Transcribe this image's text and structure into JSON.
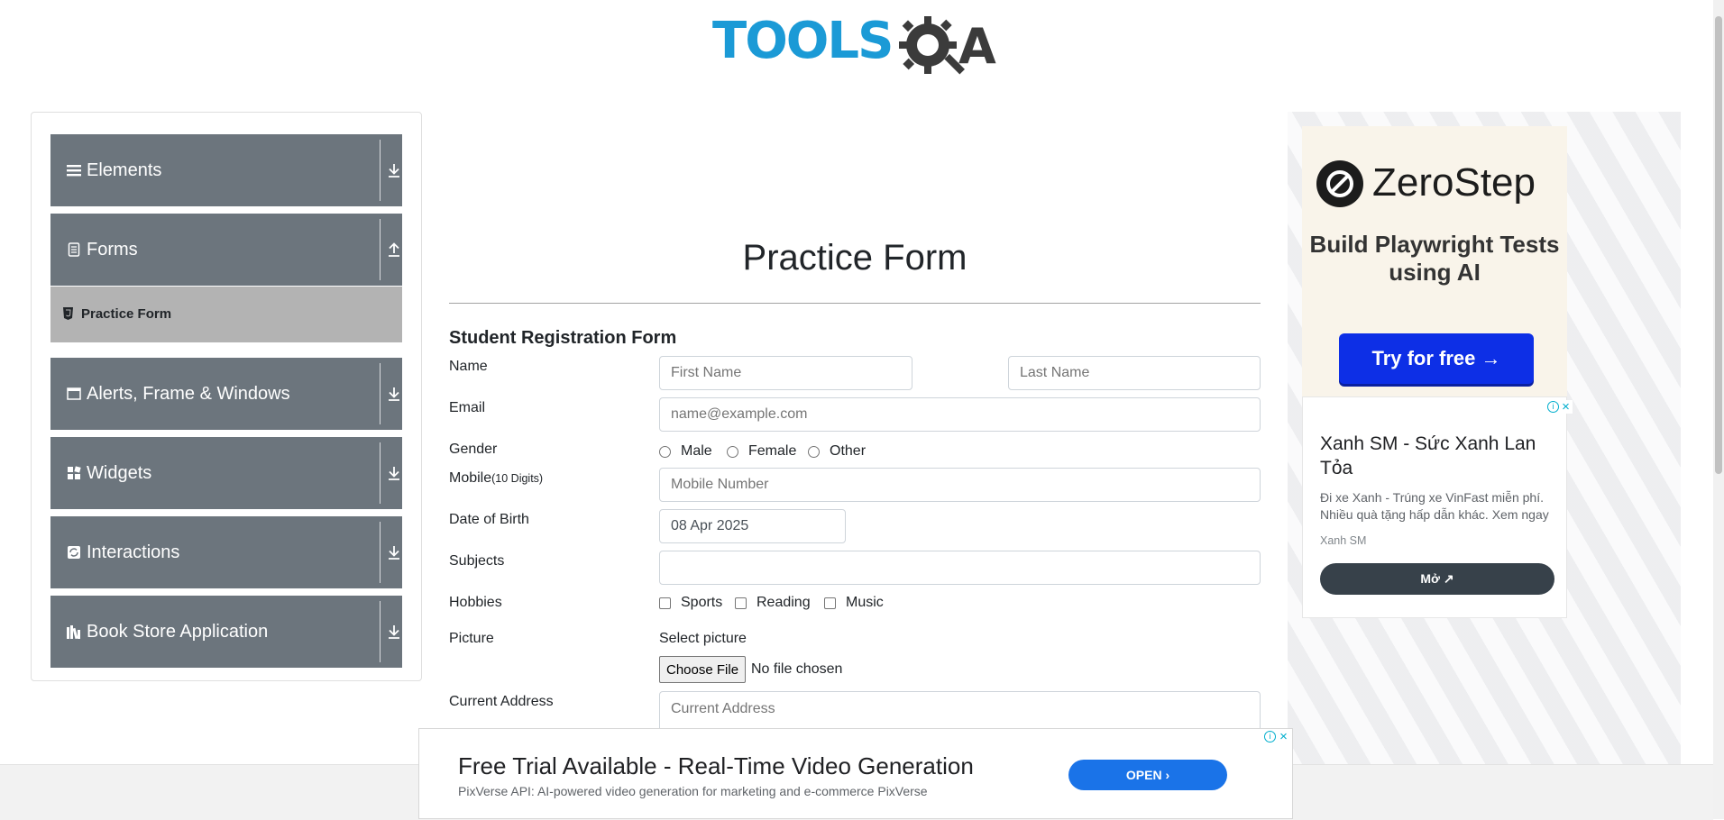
{
  "header": {
    "logo_left": "TOOLS",
    "logo_right": "QA"
  },
  "sidebar": {
    "groups": [
      {
        "label": "Elements",
        "icon": "list-icon",
        "arrow": "download-icon"
      },
      {
        "label": "Forms",
        "icon": "form-icon",
        "arrow": "upload-icon"
      },
      {
        "label": "Alerts, Frame & Windows",
        "icon": "window-icon",
        "arrow": "download-icon"
      },
      {
        "label": "Widgets",
        "icon": "widgets-icon",
        "arrow": "download-icon"
      },
      {
        "label": "Interactions",
        "icon": "interactions-icon",
        "arrow": "download-icon"
      },
      {
        "label": "Book Store Application",
        "icon": "books-icon",
        "arrow": "download-icon"
      }
    ],
    "active_item": {
      "label": "Practice Form",
      "icon": "html5-icon"
    }
  },
  "main": {
    "page_title": "Practice Form",
    "form_title": "Student Registration Form",
    "labels": {
      "name": "Name",
      "email": "Email",
      "gender": "Gender",
      "mobile": "Mobile",
      "mobile_hint": "(10 Digits)",
      "dob": "Date of Birth",
      "subjects": "Subjects",
      "hobbies": "Hobbies",
      "picture": "Picture",
      "address": "Current Address"
    },
    "placeholders": {
      "first_name": "First Name",
      "last_name": "Last Name",
      "email": "name@example.com",
      "mobile": "Mobile Number",
      "address": "Current Address"
    },
    "dob_value": "08 Apr 2025",
    "gender_options": [
      "Male",
      "Female",
      "Other"
    ],
    "hobby_options": [
      "Sports",
      "Reading",
      "Music"
    ],
    "select_picture": "Select picture",
    "choose_file": "Choose File",
    "no_file": "No file chosen"
  },
  "ads": {
    "zerostep": {
      "name": "ZeroStep",
      "headline": "Build Playwright Tests using AI",
      "cta": "Try for free →"
    },
    "xanh": {
      "title": "Xanh SM - Sức Xanh Lan Tỏa",
      "desc": "Đi xe Xanh - Trúng xe VinFast miễn phí. Nhiều quà tặng hấp dẫn khác. Xem ngay",
      "brand": "Xanh SM",
      "cta": "Mở ↗"
    },
    "banner": {
      "title": "Free Trial Available - Real-Time Video Generation",
      "desc": "PixVerse API: AI-powered video generation for marketing and e-commerce PixVerse",
      "cta": "OPEN ›"
    }
  },
  "colors": {
    "brand_blue": "#1b9ad6",
    "sidebar_group": "#6c757d",
    "active_item": "#b3b3b3",
    "cta_blue": "#0d2fe6"
  }
}
